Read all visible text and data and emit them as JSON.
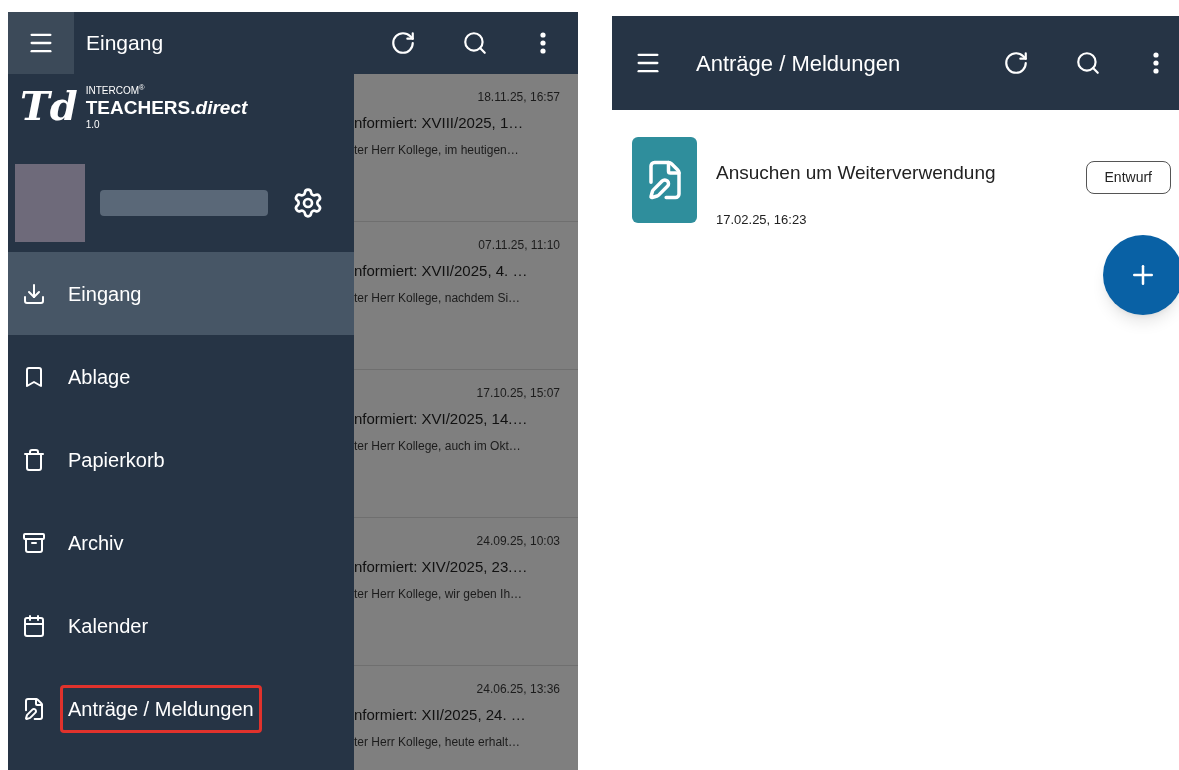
{
  "left_screen": {
    "app_bar": {
      "title": "Eingang"
    },
    "drawer": {
      "logo": {
        "mark": "Td",
        "brand_small": "INTERCOM",
        "brand_sup": "®",
        "brand_name": "TEACHERS.",
        "brand_name_italic": "direct",
        "version": "1.0"
      },
      "items": [
        {
          "label": "Eingang",
          "selected": true,
          "highlighted": false
        },
        {
          "label": "Ablage",
          "selected": false,
          "highlighted": false
        },
        {
          "label": "Papierkorb",
          "selected": false,
          "highlighted": false
        },
        {
          "label": "Archiv",
          "selected": false,
          "highlighted": false
        },
        {
          "label": "Kalender",
          "selected": false,
          "highlighted": false
        },
        {
          "label": "Anträge / Meldungen",
          "selected": false,
          "highlighted": true
        }
      ]
    },
    "messages": [
      {
        "date": "18.11.25, 16:57",
        "subject": "nformiert: XVIII/2025, 1…",
        "preview": "ter Herr Kollege, im heutigen…"
      },
      {
        "date": "07.11.25, 11:10",
        "subject": "nformiert: XVII/2025, 4. …",
        "preview": "ter Herr Kollege, nachdem Si…"
      },
      {
        "date": "17.10.25, 15:07",
        "subject": "nformiert: XVI/2025, 14.…",
        "preview": "ter Herr Kollege, auch im Okt…"
      },
      {
        "date": "24.09.25, 10:03",
        "subject": "nformiert: XIV/2025, 23.…",
        "preview": "ter Herr Kollege, wir geben Ih…"
      },
      {
        "date": "24.06.25, 13:36",
        "subject": "nformiert: XII/2025, 24. …",
        "preview": "ter Herr Kollege, heute erhalt…"
      }
    ]
  },
  "right_screen": {
    "app_bar": {
      "title": "Anträge / Meldungen"
    },
    "requests": [
      {
        "title": "Ansuchen um Weiterverwendung",
        "date": "17.02.25, 16:23",
        "status": "Entwurf"
      }
    ]
  }
}
